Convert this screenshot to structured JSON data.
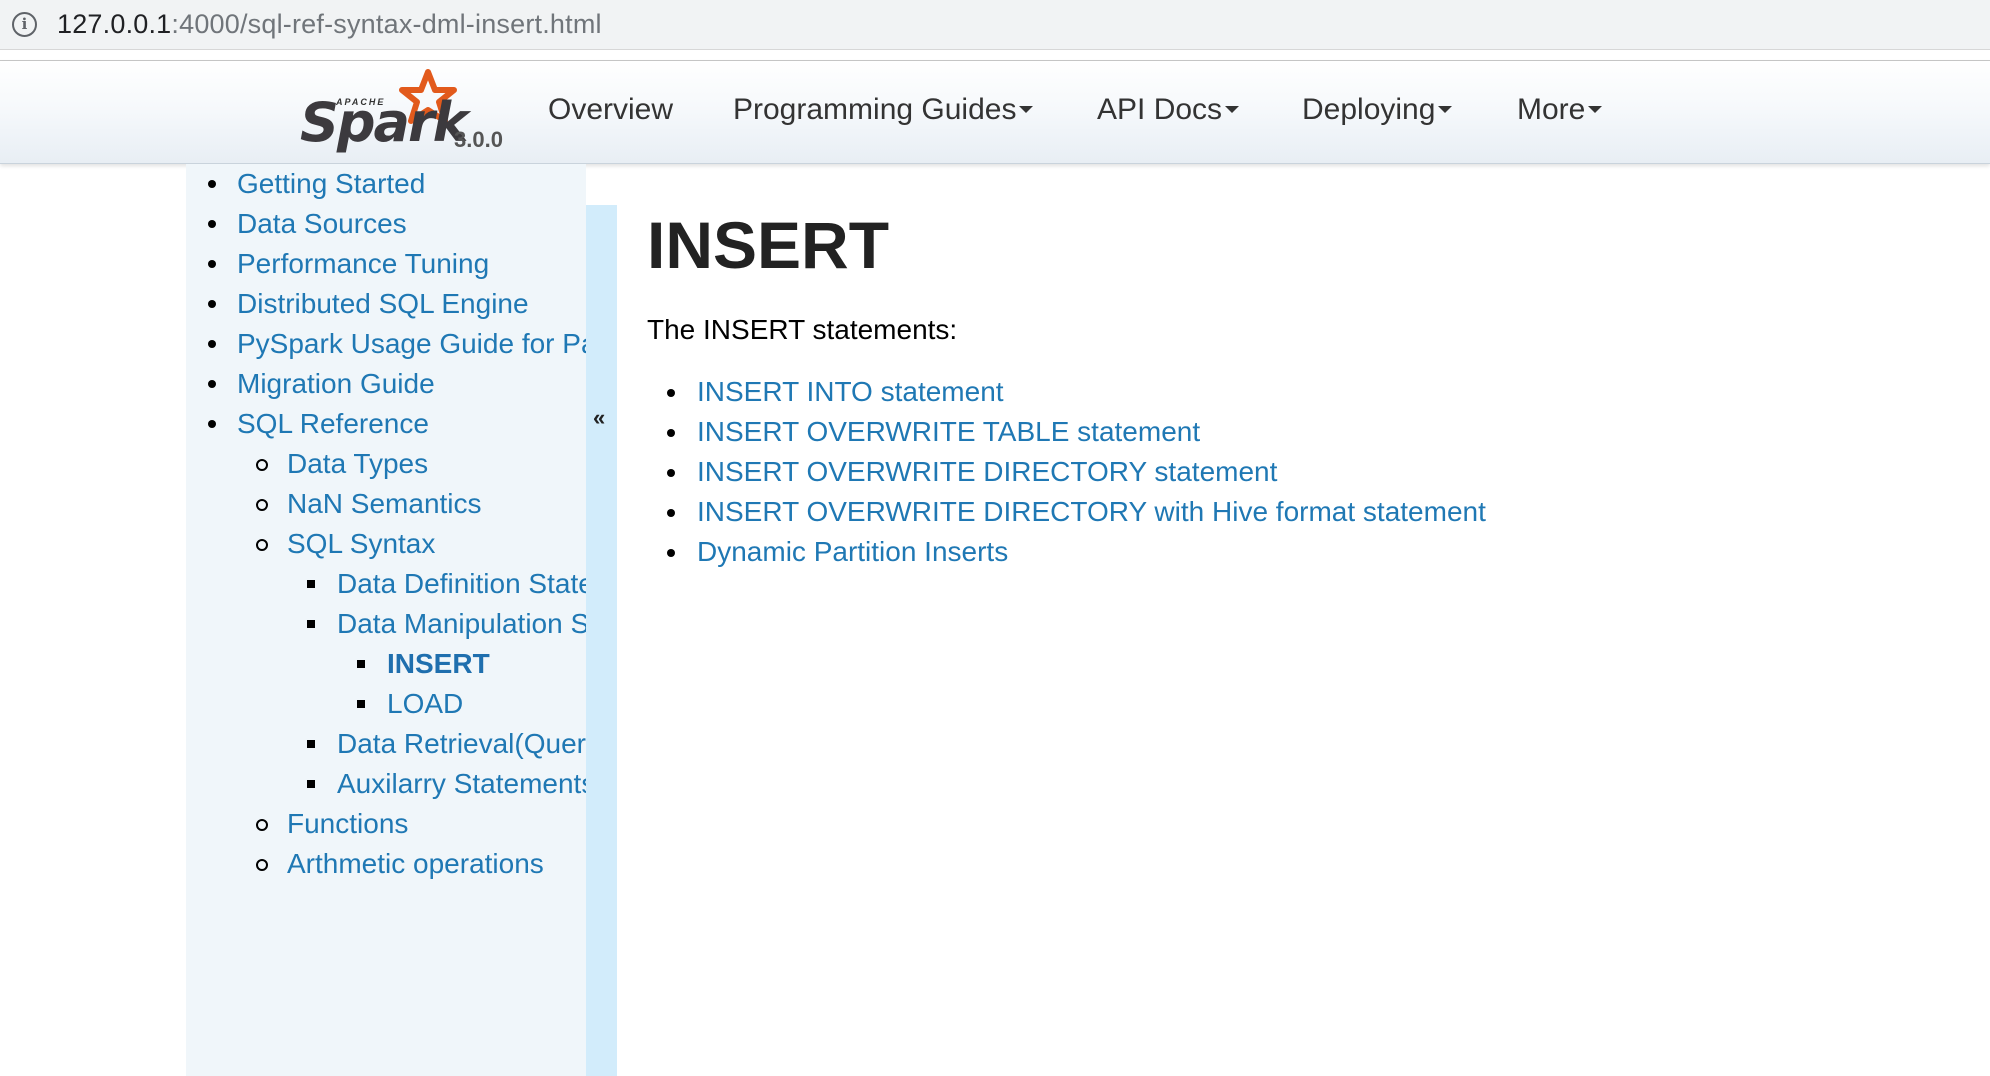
{
  "browser": {
    "url_host": "127.0.0.1",
    "url_rest": ":4000/sql-ref-syntax-dml-insert.html"
  },
  "navbar": {
    "brand_apache": "APACHE",
    "brand_name": "Spark",
    "version": "3.0.0",
    "items": [
      {
        "label": "Overview",
        "dropdown": false
      },
      {
        "label": "Programming Guides",
        "dropdown": true
      },
      {
        "label": "API Docs",
        "dropdown": true
      },
      {
        "label": "Deploying",
        "dropdown": true
      },
      {
        "label": "More",
        "dropdown": true
      }
    ]
  },
  "sidebar": {
    "items": [
      {
        "label": "Getting Started",
        "level": 1
      },
      {
        "label": "Data Sources",
        "level": 1
      },
      {
        "label": "Performance Tuning",
        "level": 1
      },
      {
        "label": "Distributed SQL Engine",
        "level": 1
      },
      {
        "label": "PySpark Usage Guide for Pandas with Apache Arrow",
        "level": 1
      },
      {
        "label": "Migration Guide",
        "level": 1
      },
      {
        "label": "SQL Reference",
        "level": 1
      },
      {
        "label": "Data Types",
        "level": 2
      },
      {
        "label": "NaN Semantics",
        "level": 2
      },
      {
        "label": "SQL Syntax",
        "level": 2
      },
      {
        "label": "Data Definition Statements",
        "level": 3
      },
      {
        "label": "Data Manipulation Statements",
        "level": 3
      },
      {
        "label": "INSERT",
        "level": 4,
        "active": true
      },
      {
        "label": "LOAD",
        "level": 4
      },
      {
        "label": "Data Retrieval(Queries)",
        "level": 3
      },
      {
        "label": "Auxilarry Statements",
        "level": 3
      },
      {
        "label": "Functions",
        "level": 2
      },
      {
        "label": "Arthmetic operations",
        "level": 2
      }
    ],
    "collapse_glyph": "«"
  },
  "main": {
    "title": "INSERT",
    "intro": "The INSERT statements:",
    "links": [
      "INSERT INTO statement",
      "INSERT OVERWRITE TABLE statement",
      "INSERT OVERWRITE DIRECTORY statement",
      "INSERT OVERWRITE DIRECTORY with Hive format statement",
      "Dynamic Partition Inserts"
    ]
  },
  "colors": {
    "link": "#1f78b4",
    "sidebar_bg": "#f0f6fa",
    "collapse_bar": "#d2ecfb",
    "spark_star": "#e25a1c"
  }
}
